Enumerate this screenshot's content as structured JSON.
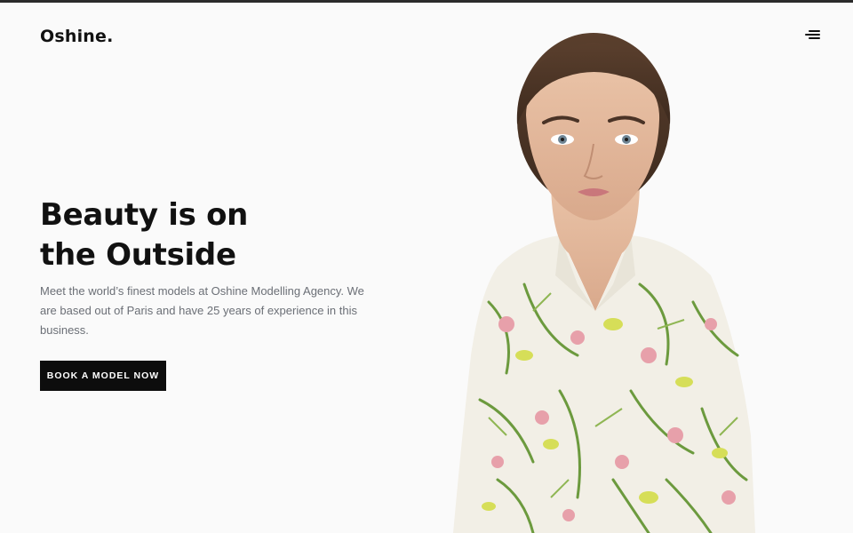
{
  "brand": {
    "name": "Oshine."
  },
  "nav": {
    "menu_icon": "hamburger-menu-icon"
  },
  "hero": {
    "title_line1": "Beauty is on",
    "title_line2": "the Outside",
    "description": "Meet the world’s finest models at Oshine Modelling Agency. We are based out of Paris and have 25 years of experience in this business.",
    "cta_label": "BOOK A MODEL NOW"
  },
  "colors": {
    "background": "#fafafa",
    "text": "#111111",
    "muted": "#6b6f76",
    "button": "#0d0d0d"
  }
}
